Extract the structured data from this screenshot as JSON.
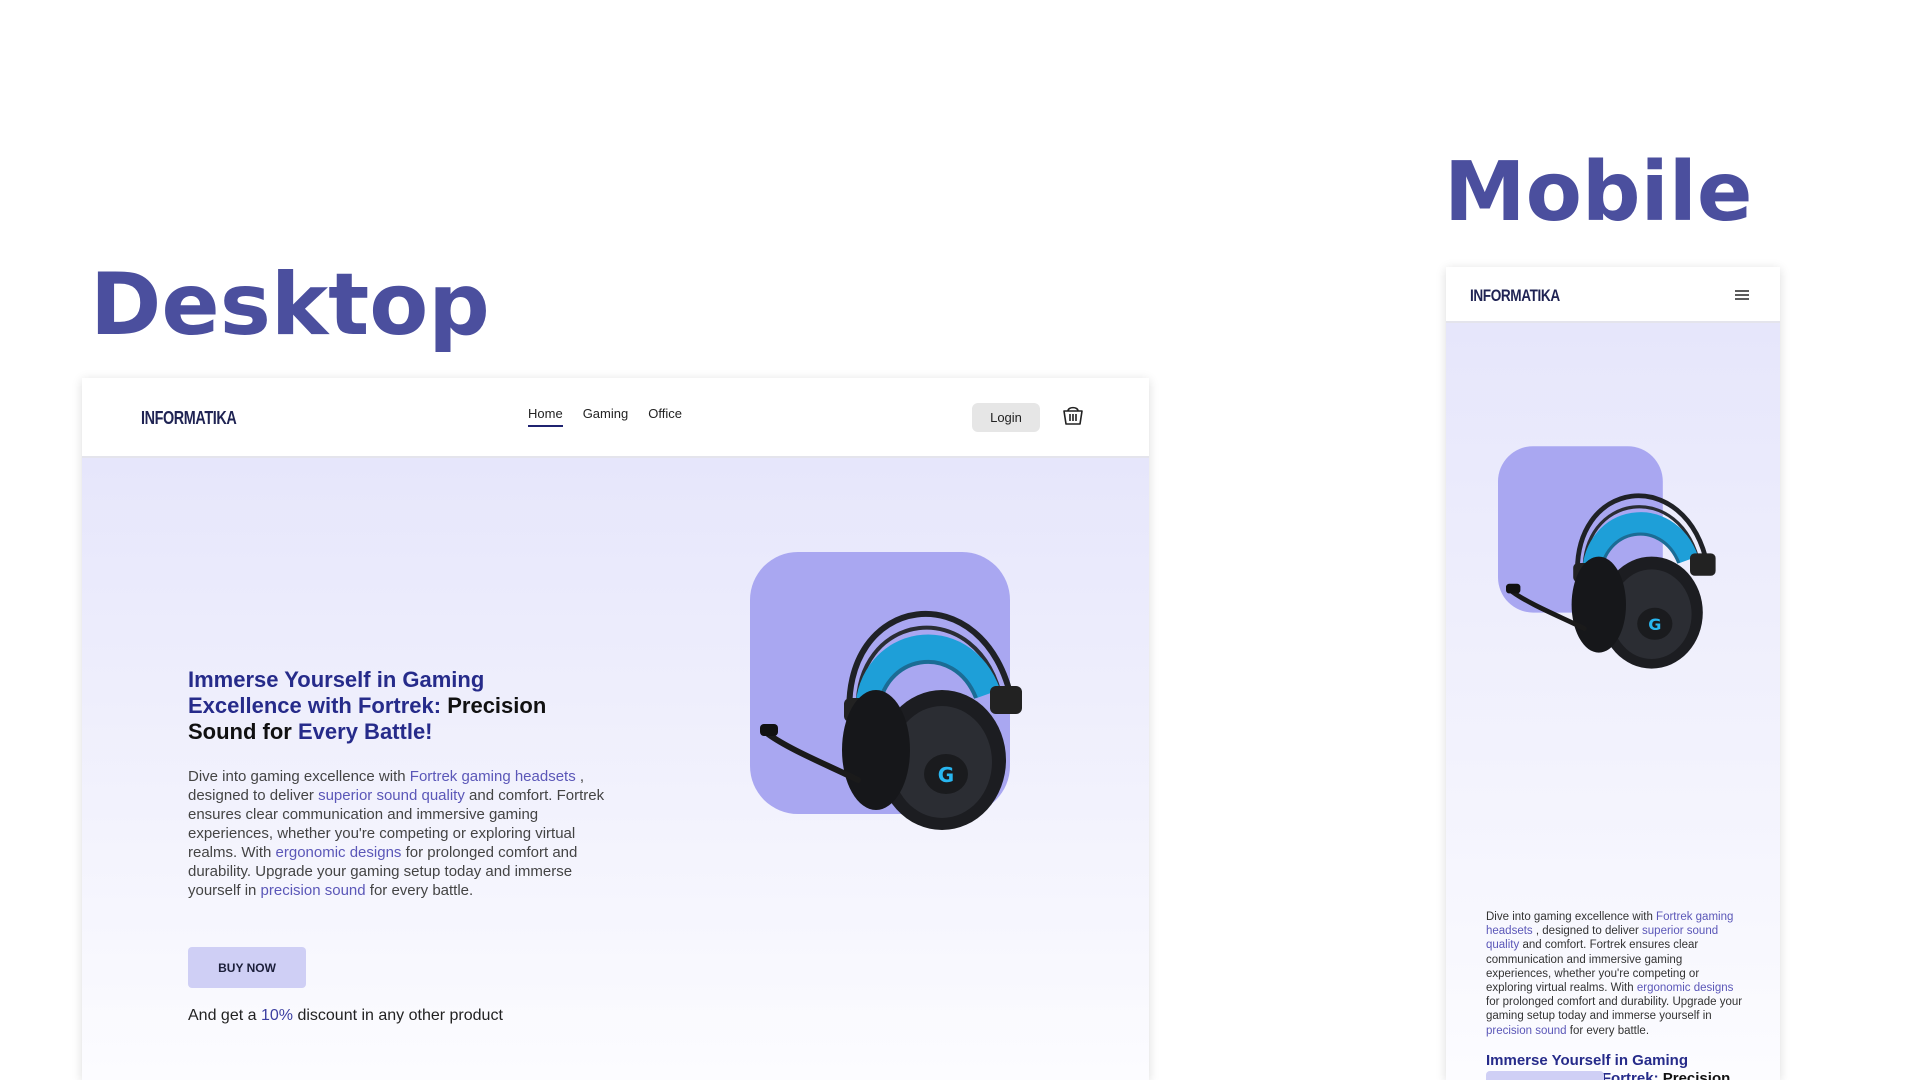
{
  "labels": {
    "desktop": "Desktop",
    "mobile": "Mobile"
  },
  "brand": {
    "logo": "INFORMATIKA"
  },
  "nav": {
    "items": [
      {
        "label": "Home",
        "active": true
      },
      {
        "label": "Gaming",
        "active": false
      },
      {
        "label": "Office",
        "active": false
      }
    ],
    "login_label": "Login"
  },
  "hero": {
    "headline": {
      "part1": "Immerse Yourself in Gaming Excellence with Fortrek:",
      "part2": "Precision Sound for",
      "part3": "Every Battle!"
    },
    "body": {
      "s1": "Dive into gaming excellence with",
      "h1": "Fortrek gaming headsets",
      "s2": ", designed to deliver",
      "h2": "superior sound quality",
      "s3": "and comfort. Fortrek ensures clear communication and immersive gaming experiences, whether you're competing or exploring virtual realms. With",
      "h3": "ergonomic designs",
      "s4": "for prolonged comfort and durability. Upgrade your gaming setup today and immerse yourself in",
      "h4": "precision sound",
      "s5": "for every battle."
    },
    "cta_label": "BUY NOW",
    "discount": {
      "prefix": "And get a",
      "value": "10%",
      "suffix": "discount in any other product"
    }
  },
  "product": {
    "name": "headset-image"
  },
  "icons": [
    "cart-icon",
    "hamburger-menu-icon"
  ],
  "colors": {
    "accent": "#262b8a",
    "title": "#4b4f9e",
    "hero_bg": "#e6e6fb",
    "product_bg": "#a9a7f1",
    "button_bg": "#cfcff5",
    "headset_blue": "#1e9fd8"
  }
}
